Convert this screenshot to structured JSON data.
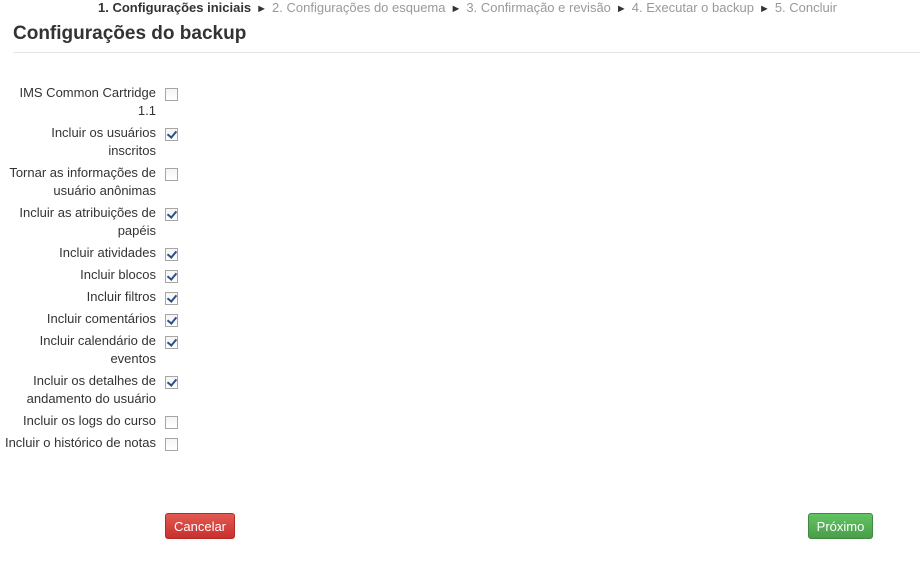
{
  "progress": {
    "steps": [
      "1. Configurações iniciais",
      "2. Configurações do esquema",
      "3. Confirmação e revisão",
      "4. Executar o backup",
      "5. Concluir"
    ],
    "separator": "►"
  },
  "heading": "Configurações do backup",
  "settings": [
    {
      "label": "IMS Common Cartridge 1.1",
      "checked": false
    },
    {
      "label": "Incluir os usuários inscritos",
      "checked": true
    },
    {
      "label": "Tornar as informações de usuário anônimas",
      "checked": false
    },
    {
      "label": "Incluir as atribuições de papéis",
      "checked": true
    },
    {
      "label": "Incluir atividades",
      "checked": true
    },
    {
      "label": "Incluir blocos",
      "checked": true
    },
    {
      "label": "Incluir filtros",
      "checked": true
    },
    {
      "label": "Incluir comentários",
      "checked": true
    },
    {
      "label": "Incluir calendário de eventos",
      "checked": true
    },
    {
      "label": "Incluir os detalhes de andamento do usuário",
      "checked": true
    },
    {
      "label": "Incluir os logs do curso",
      "checked": false
    },
    {
      "label": "Incluir o histórico de notas",
      "checked": false
    }
  ],
  "buttons": {
    "cancel": "Cancelar",
    "next": "Próximo"
  }
}
